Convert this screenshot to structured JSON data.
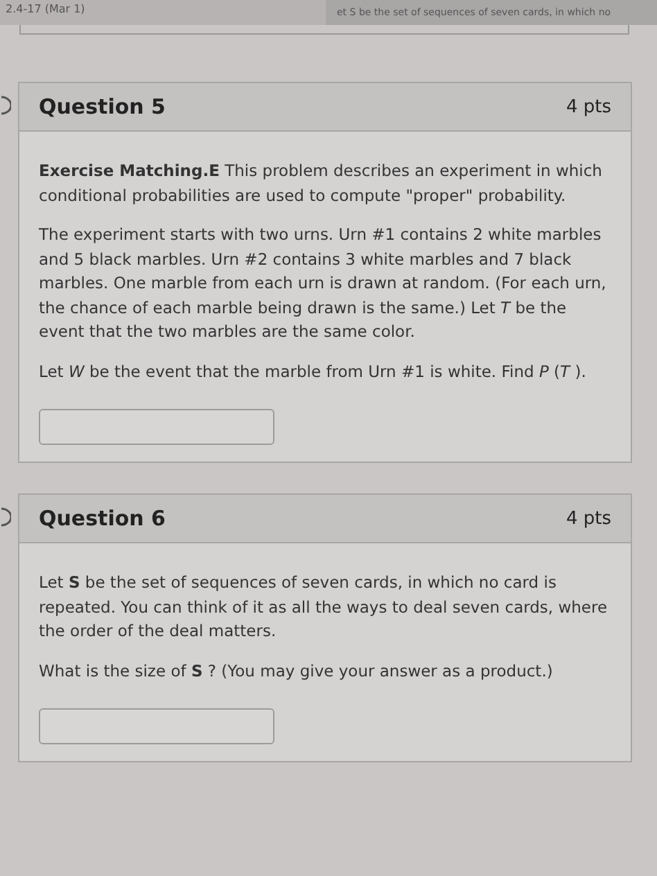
{
  "top_bar": {
    "left_text": "2.4-17 (Mar 1)",
    "right_text": "et S be the set of sequences of seven cards, in which no"
  },
  "questions": [
    {
      "title": "Question 5",
      "points": "4 pts",
      "paragraphs": [
        "**Exercise Matching.E** This problem describes an experiment in which conditional probabilities are used to compute \"proper\" probability.",
        "The experiment starts with two urns. Urn #1 contains 2 white marbles and 5 black marbles. Urn #2 contains 3 white marbles and 7 black marbles. One marble from each urn is drawn at random. (For each urn, the chance of each marble being drawn is the same.) Let *T* be the event that the two marbles are the same color.",
        "Let *W* be the event that the marble from Urn #1 is white. Find *P* (*T* )."
      ]
    },
    {
      "title": "Question 6",
      "points": "4 pts",
      "paragraphs": [
        "Let **S** be the set of sequences of seven cards, in which no card is repeated. You can think of it as all the ways to deal seven cards, where the order of the deal matters.",
        "What is the size of **S** ? (You may give your answer as a product.)"
      ]
    }
  ]
}
